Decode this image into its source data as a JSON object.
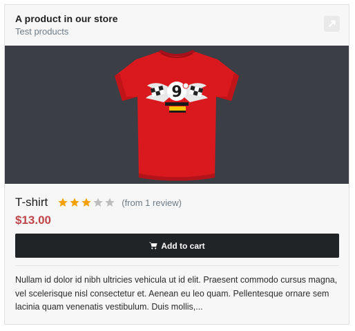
{
  "card": {
    "title": "A product in our store",
    "subtitle": "Test products",
    "open_icon": "external-link-icon"
  },
  "product": {
    "image_alt": "red t-shirt",
    "name": "T-shirt",
    "rating": 3,
    "rating_max": 5,
    "reviews": "(from 1 review)",
    "price": "$13.00",
    "add_to_cart": "Add to cart",
    "description": "Nullam id dolor id nibh ultricies vehicula ut id elit. Praesent commodo cursus magna, vel scelerisque nisl consectetur et. Aenean eu leo quam. Pellentesque ornare sem lacinia quam venenatis vestibulum. Duis mollis,..."
  },
  "colors": {
    "price": "#c0454a",
    "star_filled": "#f5a100",
    "star_empty": "#bdbdbd",
    "button": "#212427",
    "media_bg": "#3b3f45",
    "shirt": "#d9191e"
  }
}
